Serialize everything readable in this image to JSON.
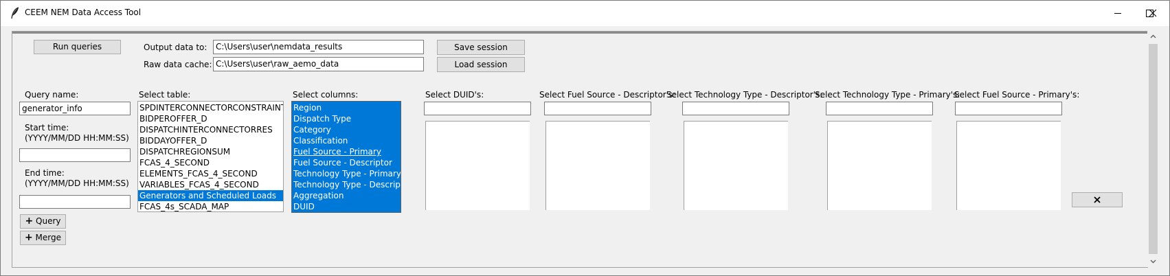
{
  "window": {
    "title": "CEEM NEM Data Access Tool",
    "icon": "feather-icon",
    "controls": [
      "minimize-icon",
      "maximize-icon",
      "close-icon"
    ]
  },
  "toolbar": {
    "run_label": "Run queries",
    "output_label": "Output data to:",
    "output_value": "C:\\Users\\user\\nemdata_results",
    "cache_label": "Raw data cache:",
    "cache_value": "C:\\Users\\user\\raw_aemo_data",
    "save_label": "Save session",
    "load_label": "Load session"
  },
  "query": {
    "name_label": "Query name:",
    "name_value": "generator_info",
    "start_label": "Start time:",
    "start_format": "(YYYY/MM/DD HH:MM:SS)",
    "start_value": "",
    "end_label": "End time:",
    "end_format": "(YYYY/MM/DD HH:MM:SS)",
    "end_value": "",
    "add_query_label": "Query",
    "add_merge_label": "Merge"
  },
  "tables": {
    "label": "Select table:",
    "items": [
      "SPDINTERCONNECTORCONSTRAINT",
      "BIDPEROFFER_D",
      "DISPATCHINTERCONNECTORRES",
      "BIDDAYOFFER_D",
      "DISPATCHREGIONSUM",
      "FCAS_4_SECOND",
      "ELEMENTS_FCAS_4_SECOND",
      "VARIABLES_FCAS_4_SECOND",
      "Generators and Scheduled Loads",
      "FCAS_4s_SCADA_MAP"
    ],
    "selected": "Generators and Scheduled Loads"
  },
  "columns": {
    "label": "Select columns:",
    "items": [
      "Region",
      "Dispatch Type",
      "Category",
      "Classification",
      "Fuel Source - Primary",
      "Fuel Source - Descriptor",
      "Technology Type - Primary",
      "Technology Type - Descriptor",
      "Aggregation",
      "DUID"
    ],
    "active": "Fuel Source - Primary"
  },
  "filters": {
    "duid": "Select DUID's:",
    "fuel_desc": "Select Fuel Source - Descriptor's:",
    "tech_desc": "Select Technology Type - Descriptor's:",
    "tech_primary": "Select Technology Type - Primary's:",
    "fuel_primary": "Select Fuel Source - Primary's:"
  },
  "colors": {
    "selection": "#0078d7",
    "window_bg": "#f0f0f0"
  }
}
